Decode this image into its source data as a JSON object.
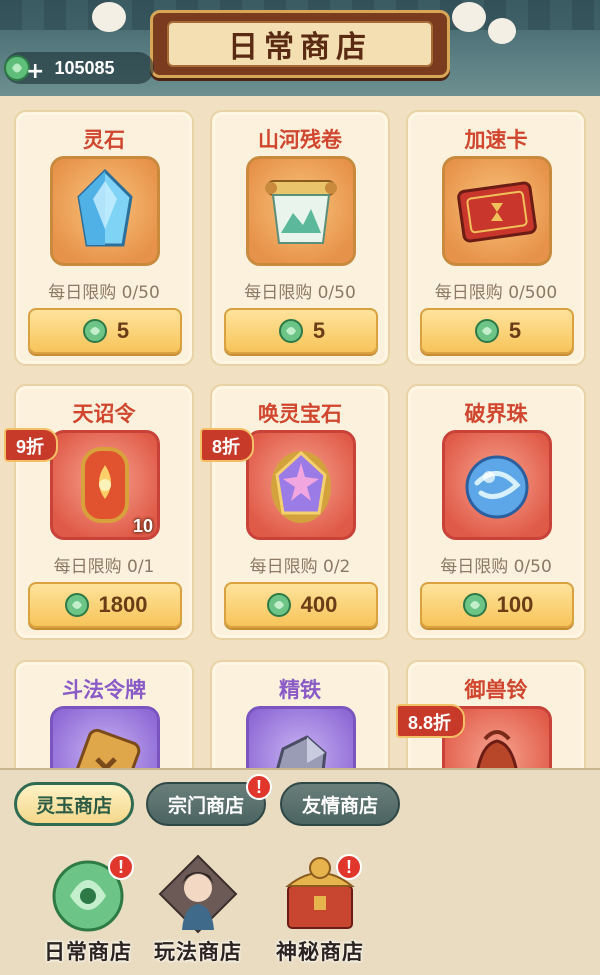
{
  "header": {
    "title": "日常商店",
    "currency_amount": "105085",
    "currency_icon": "jade-coin-icon"
  },
  "items": [
    {
      "name": "灵石",
      "limit": "每日限购 0/50",
      "price": "5",
      "icon": "spirit-stone-icon",
      "name_color": "red",
      "box": "gold"
    },
    {
      "name": "山河残卷",
      "limit": "每日限购 0/50",
      "price": "5",
      "icon": "scroll-icon",
      "name_color": "red",
      "box": "gold"
    },
    {
      "name": "加速卡",
      "limit": "每日限购 0/500",
      "price": "5",
      "icon": "speed-card-icon",
      "name_color": "red",
      "box": "gold"
    },
    {
      "name": "天诏令",
      "limit": "每日限购 0/1",
      "price": "1800",
      "icon": "decree-token-icon",
      "discount": "9折",
      "quantity": "10",
      "name_color": "red",
      "box": "red"
    },
    {
      "name": "唤灵宝石",
      "limit": "每日限购 0/2",
      "price": "400",
      "icon": "summon-gem-icon",
      "discount": "8折",
      "name_color": "red",
      "box": "red"
    },
    {
      "name": "破界珠",
      "limit": "每日限购 0/50",
      "price": "100",
      "icon": "realm-orb-icon",
      "name_color": "red",
      "box": "red"
    },
    {
      "name": "斗法令牌",
      "icon": "duel-token-icon",
      "name_color": "purple",
      "box": "purple"
    },
    {
      "name": "精铁",
      "icon": "iron-ore-icon",
      "name_color": "purple",
      "box": "purple"
    },
    {
      "name": "御兽铃",
      "icon": "beast-bell-icon",
      "discount": "8.8折",
      "name_color": "red",
      "box": "red"
    }
  ],
  "subtabs": [
    {
      "label": "灵玉商店",
      "active": true,
      "alert": false
    },
    {
      "label": "宗门商店",
      "active": false,
      "alert": true
    },
    {
      "label": "友情商店",
      "active": false,
      "alert": false
    }
  ],
  "maintabs": [
    {
      "label": "日常商店",
      "icon": "jade-pendant-icon",
      "alert": true
    },
    {
      "label": "玩法商店",
      "icon": "character-portrait-icon",
      "alert": false
    },
    {
      "label": "神秘商店",
      "icon": "treasure-chest-icon",
      "alert": true
    }
  ],
  "alert_symbol": "!",
  "colors": {
    "accent_red": "#d1462f",
    "accent_purple": "#8a5bc7",
    "button_gold": "#f7c45a",
    "tab_green": "#2f6b52"
  }
}
